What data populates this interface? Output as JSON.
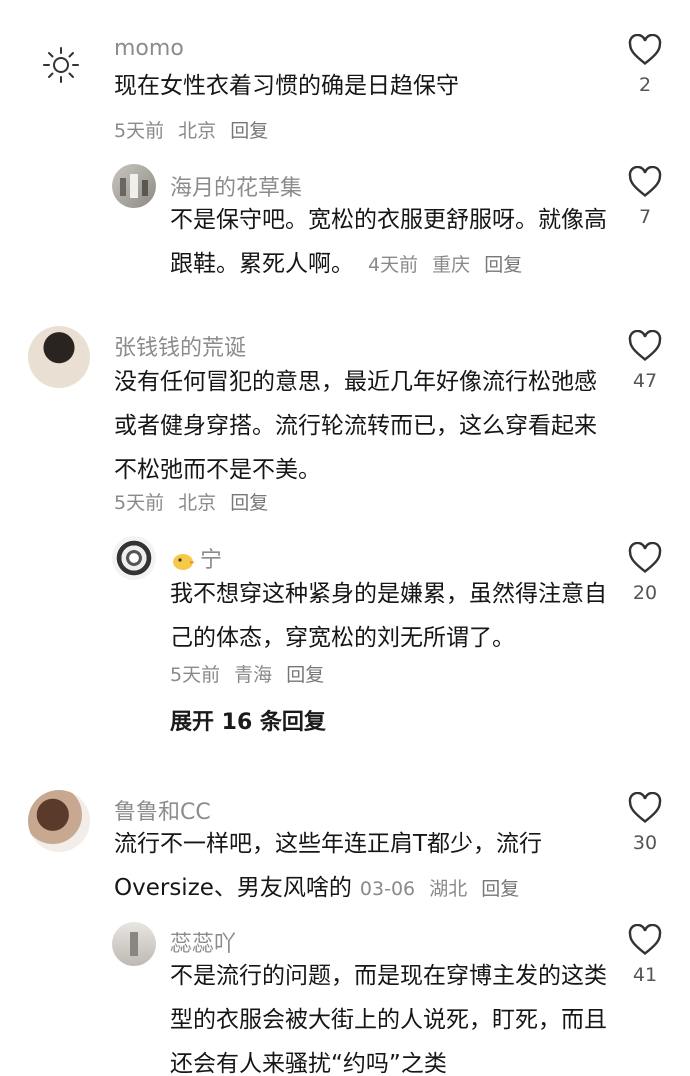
{
  "comments": [
    {
      "name": "momo",
      "text": "现在女性衣着习惯的确是日趋保守",
      "time": "5天前",
      "location": "北京",
      "reply": "回复",
      "likes": "2",
      "avatar_icon": "sun-icon"
    },
    {
      "name": "海月的花草集",
      "text": "不是保守吧。宽松的衣服更舒服呀。就像高跟鞋。累死人啊。",
      "time": "4天前",
      "location": "重庆",
      "reply": "回复",
      "likes": "7"
    },
    {
      "name": "张钱钱的荒诞",
      "text": "没有任何冒犯的意思，最近几年好像流行松弛感或者健身穿搭。流行轮流转而已，这么穿看起来不松弛而不是不美。",
      "time": "5天前",
      "location": "北京",
      "reply": "回复",
      "likes": "47"
    },
    {
      "name": "宁",
      "text": "我不想穿这种紧身的是嫌累，虽然得注意自己的体态，穿宽松的刘无所谓了。",
      "time": "5天前",
      "location": "青海",
      "reply": "回复",
      "likes": "20",
      "name_icon": "chick-emoji-icon"
    },
    {
      "name": "鲁鲁和CC",
      "text_line1": "流行不一样吧，这些年连正肩T都少，流行",
      "text_line2": "Oversize、男友风啥的",
      "time": "03-06",
      "location": "湖北",
      "reply": "回复",
      "likes": "30"
    },
    {
      "name": "蕊蕊吖",
      "text": "不是流行的问题，而是现在穿博主发的这类型的衣服会被大街上的人说死，盯死，而且还会有人来骚扰“约吗”之类",
      "likes": "41"
    }
  ],
  "expand_replies": "展开 16 条回复",
  "colors": {
    "name": "#8c8c8c",
    "text": "#161616",
    "meta": "#8a8a8a"
  }
}
